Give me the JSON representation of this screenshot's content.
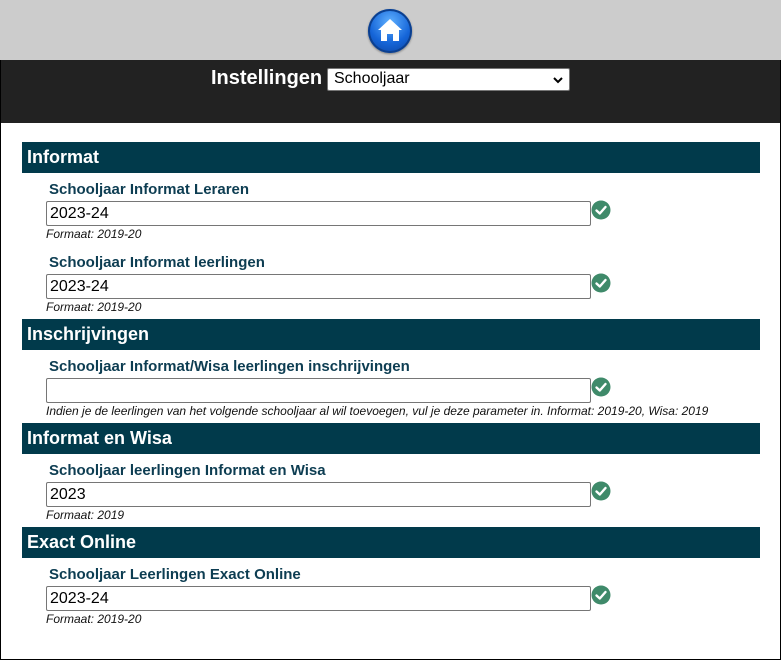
{
  "nav": {
    "home_icon": "home-icon"
  },
  "header": {
    "title": "Instellingen",
    "select_value": "Schooljaar"
  },
  "sections": [
    {
      "title": "Informat",
      "fields": [
        {
          "label": "Schooljaar Informat Leraren",
          "value": "2023-24",
          "hint": "Formaat: 2019-20"
        },
        {
          "label": "Schooljaar Informat leerlingen",
          "value": "2023-24",
          "hint": "Formaat: 2019-20"
        }
      ]
    },
    {
      "title": "Inschrijvingen",
      "fields": [
        {
          "label": "Schooljaar Informat/Wisa leerlingen inschrijvingen",
          "value": "",
          "hint": "Indien je de leerlingen van het volgende schooljaar al wil toevoegen, vul je deze parameter in. Informat: 2019-20, Wisa: 2019"
        }
      ]
    },
    {
      "title": "Informat en Wisa",
      "fields": [
        {
          "label": "Schooljaar leerlingen Informat en Wisa",
          "value": "2023",
          "hint": "Formaat: 2019"
        }
      ]
    },
    {
      "title": "Exact Online",
      "fields": [
        {
          "label": "Schooljaar Leerlingen Exact Online",
          "value": "2023-24",
          "hint": "Formaat: 2019-20"
        }
      ]
    }
  ],
  "colors": {
    "section_bar": "#013a4b",
    "label": "#0d3d52",
    "check": "#3f8a6a",
    "header_bg": "#222222",
    "top_bg": "#cccccc"
  }
}
